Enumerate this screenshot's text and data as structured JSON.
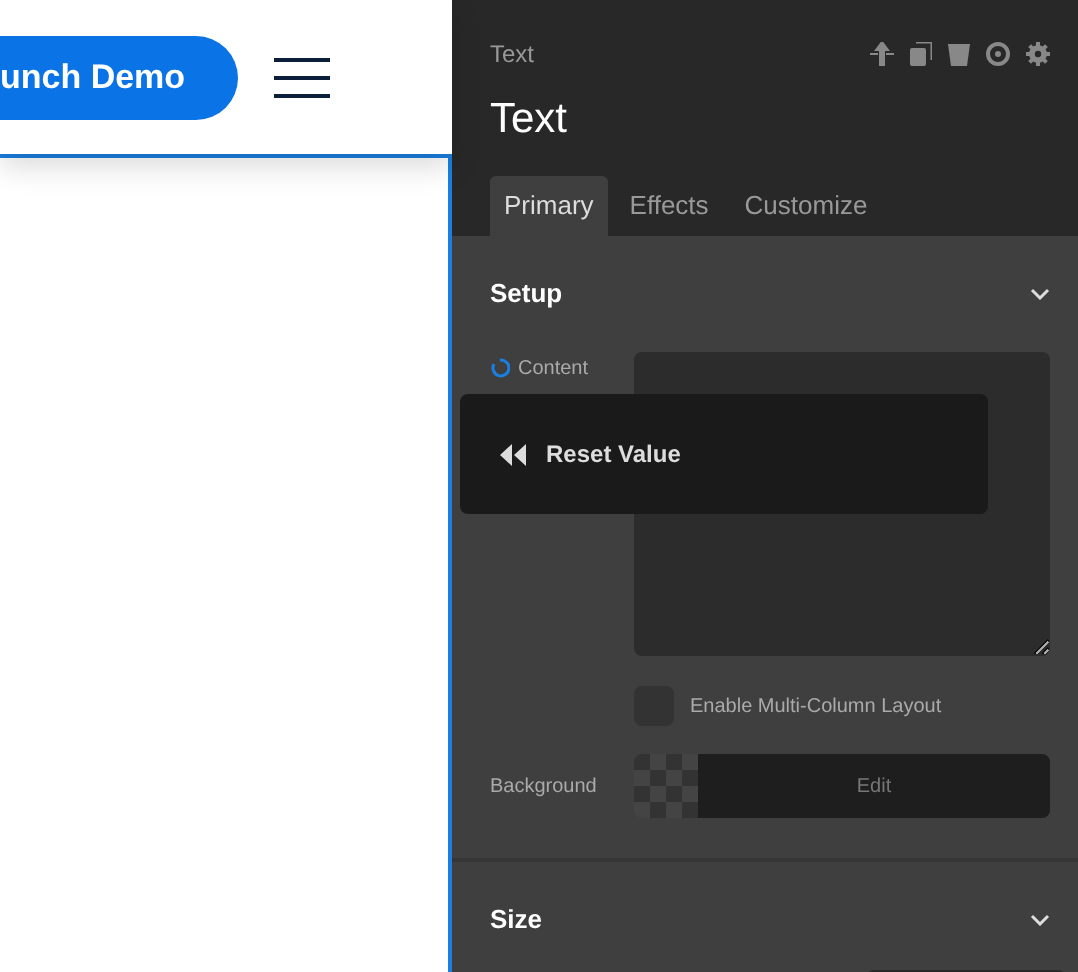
{
  "header": {
    "demo_button": "unch Demo"
  },
  "panel": {
    "breadcrumb": "Text",
    "title": "Text",
    "tabs": [
      {
        "label": "Primary",
        "selected": true
      },
      {
        "label": "Effects",
        "selected": false
      },
      {
        "label": "Customize",
        "selected": false
      }
    ],
    "setup": {
      "title": "Setup",
      "content_label": "Content",
      "tooltip": "Reset Value",
      "checkbox": {
        "label": "Enable Multi-Column Layout",
        "checked": false
      },
      "background": {
        "label": "Background",
        "button": "Edit"
      }
    },
    "size": {
      "title": "Size"
    }
  }
}
